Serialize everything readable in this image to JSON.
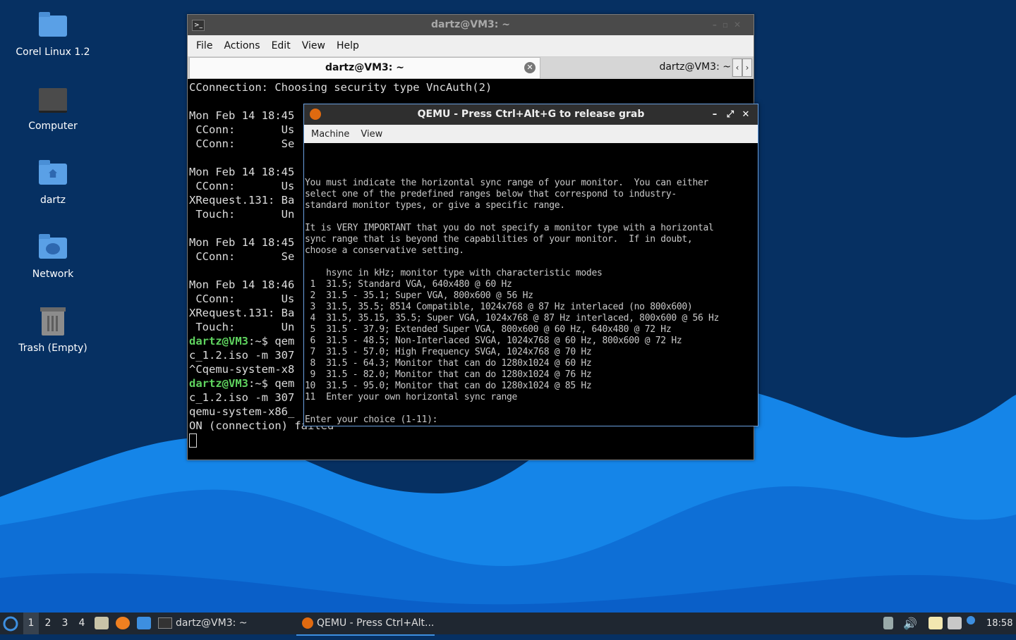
{
  "desktop": {
    "icons": [
      {
        "label": "Corel Linux 1.2",
        "icon": "folder-icon"
      },
      {
        "label": "Computer",
        "icon": "computer-icon"
      },
      {
        "label": "dartz",
        "icon": "home-folder-icon"
      },
      {
        "label": "Network",
        "icon": "network-folder-icon"
      },
      {
        "label": "Trash (Empty)",
        "icon": "trash-icon"
      }
    ],
    "colors": {
      "background": "#063062",
      "wave_light": "#1a8ff0",
      "wave_dark": "#0a5fc8"
    }
  },
  "terminal": {
    "title": "dartz@VM3: ~",
    "menu": [
      "File",
      "Actions",
      "Edit",
      "View",
      "Help"
    ],
    "tabs": [
      {
        "label": "dartz@VM3: ~",
        "active": true
      },
      {
        "label": "dartz@VM3: ~",
        "active": false
      }
    ],
    "lines": [
      "CConnection: Choosing security type VncAuth(2)",
      "",
      "Mon Feb 14 18:45",
      " CConn:       Us",
      " CConn:       Se",
      "",
      "Mon Feb 14 18:45",
      " CConn:       Us",
      "XRequest.131: Ba",
      " Touch:       Un",
      "",
      "Mon Feb 14 18:45",
      " CConn:       Se",
      "",
      "Mon Feb 14 18:46",
      " CConn:       Us",
      "XRequest.131: Ba",
      " Touch:       Un"
    ],
    "prompt_user": "dartz@VM3",
    "prompt_path": ":~$",
    "cmd1_fragment": " qem",
    "line_after_cmd1": "c_1.2.iso -m 307",
    "line_ctrl": "^Cqemu-system-x8",
    "cmd2_fragment": " qem",
    "line_after_cmd2": "c_1.2.iso -m 307",
    "line_err1": "qemu-system-x86_",
    "line_err2": "ON (connection)",
    "line_err2_tail": " failed"
  },
  "qemu": {
    "title": "QEMU - Press Ctrl+Alt+G to release grab",
    "menu": [
      "Machine",
      "View"
    ],
    "screen_lines": [
      "You must indicate the horizontal sync range of your monitor.  You can either",
      "select one of the predefined ranges below that correspond to industry-",
      "standard monitor types, or give a specific range.",
      "",
      "It is VERY IMPORTANT that you do not specify a monitor type with a horizontal",
      "sync range that is beyond the capabilities of your monitor.  If in doubt,",
      "choose a conservative setting.",
      "",
      "    hsync in kHz; monitor type with characteristic modes",
      " 1  31.5; Standard VGA, 640x480 @ 60 Hz",
      " 2  31.5 - 35.1; Super VGA, 800x600 @ 56 Hz",
      " 3  31.5, 35.5; 8514 Compatible, 1024x768 @ 87 Hz interlaced (no 800x600)",
      " 4  31.5, 35.15, 35.5; Super VGA, 1024x768 @ 87 Hz interlaced, 800x600 @ 56 Hz",
      " 5  31.5 - 37.9; Extended Super VGA, 800x600 @ 60 Hz, 640x480 @ 72 Hz",
      " 6  31.5 - 48.5; Non-Interlaced SVGA, 1024x768 @ 60 Hz, 800x600 @ 72 Hz",
      " 7  31.5 - 57.0; High Frequency SVGA, 1024x768 @ 70 Hz",
      " 8  31.5 - 64.3; Monitor that can do 1280x1024 @ 60 Hz",
      " 9  31.5 - 82.0; Monitor that can do 1280x1024 @ 76 Hz",
      "10  31.5 - 95.0; Monitor that can do 1280x1024 @ 85 Hz",
      "11  Enter your own horizontal sync range",
      "",
      "Enter your choice (1-11):"
    ]
  },
  "taskbar": {
    "workspaces": [
      "1",
      "2",
      "3",
      "4"
    ],
    "active_workspace": "1",
    "tasks": [
      {
        "label": "dartz@VM3: ~",
        "icon": "terminal-icon",
        "active": false
      },
      {
        "label": "QEMU - Press Ctrl+Alt...",
        "icon": "qemu-icon",
        "active": true
      }
    ],
    "clock": "18:58"
  }
}
